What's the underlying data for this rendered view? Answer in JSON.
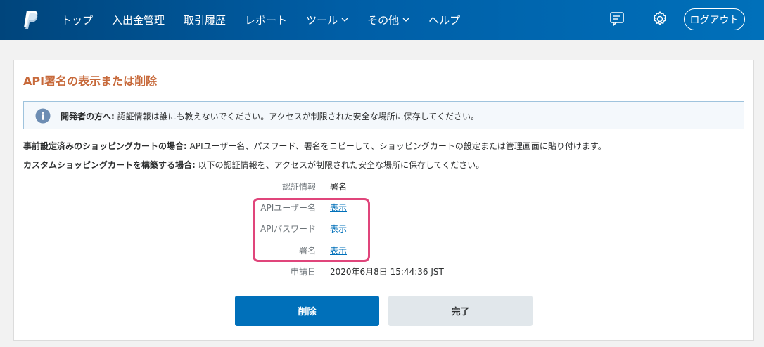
{
  "nav": {
    "items": [
      {
        "label": "トップ",
        "dropdown": false
      },
      {
        "label": "入出金管理",
        "dropdown": false
      },
      {
        "label": "取引履歴",
        "dropdown": false
      },
      {
        "label": "レポート",
        "dropdown": false
      },
      {
        "label": "ツール",
        "dropdown": true
      },
      {
        "label": "その他",
        "dropdown": true
      },
      {
        "label": "ヘルプ",
        "dropdown": false
      }
    ],
    "logout_label": "ログアウト",
    "icons": {
      "logo": "paypal-logo",
      "messages": "message-icon",
      "settings": "gear-icon"
    }
  },
  "page": {
    "title": "API署名の表示または削除"
  },
  "info": {
    "bold": "開発者の方へ:",
    "text": " 認証情報は誰にも教えないでください。アクセスが制限された安全な場所に保存してください。"
  },
  "paragraphs": [
    {
      "bold": "事前設定済みのショッピングカートの場合:",
      "text": " APIユーザー名、パスワード、署名をコピーして、ショッピングカートの設定または管理画面に貼り付けます。"
    },
    {
      "bold": "カスタムショッピングカートを構築する場合:",
      "text": " 以下の認証情報を、アクセスが制限された安全な場所に保存してください。"
    }
  ],
  "credentials": {
    "type_label": "認証情報",
    "type_value": "署名",
    "username_label": "APIユーザー名",
    "password_label": "APIパスワード",
    "signature_label": "署名",
    "show_link": "表示",
    "date_label": "申請日",
    "date_value": "2020年6月8日 15:44:36 JST"
  },
  "buttons": {
    "delete": "削除",
    "done": "完了"
  },
  "colors": {
    "nav_bg": "#005ea6",
    "title": "#c7693a",
    "link": "#0070ba",
    "primary_button": "#0070ba",
    "highlight": "#e0457b"
  }
}
